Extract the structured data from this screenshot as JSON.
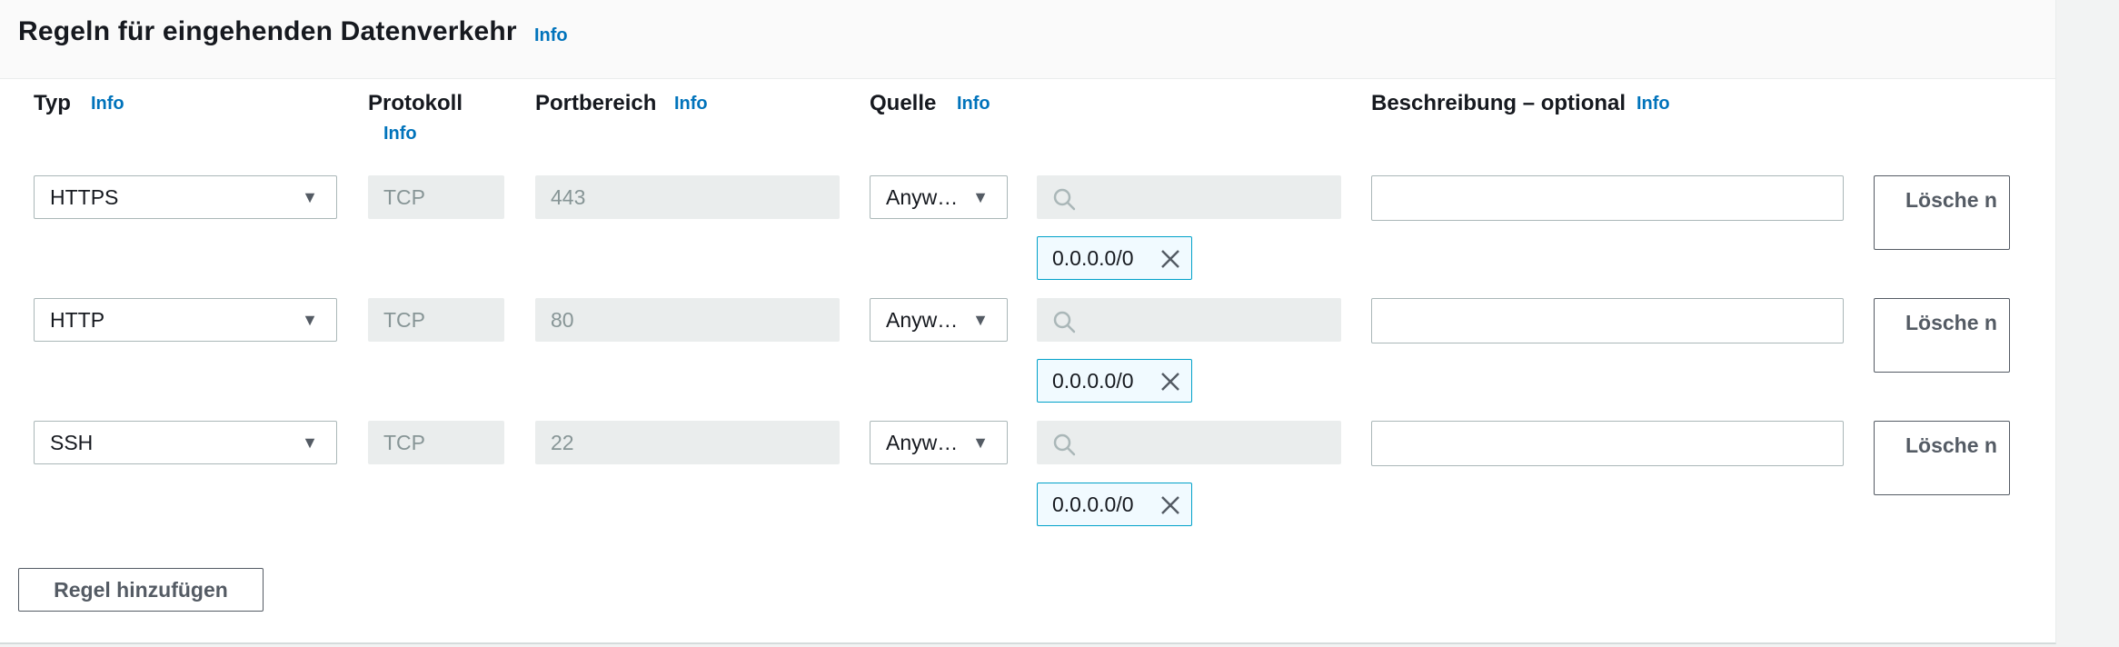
{
  "section": {
    "title": "Regeln für eingehenden Datenverkehr",
    "info": "Info"
  },
  "columns": {
    "type": {
      "label": "Typ",
      "info": "Info"
    },
    "protocol": {
      "label": "Protokoll",
      "info": "Info"
    },
    "port_range": {
      "label": "Portbereich",
      "info": "Info"
    },
    "source": {
      "label": "Quelle",
      "info": "Info"
    },
    "description": {
      "label": "Beschreibung – optional",
      "info": "Info"
    }
  },
  "rules": [
    {
      "type": "HTTPS",
      "protocol": "TCP",
      "port_range": "443",
      "source_type": "Anyw…",
      "search_value": "",
      "cidr": "0.0.0.0/0",
      "description": "",
      "delete_label": "Lösche n"
    },
    {
      "type": "HTTP",
      "protocol": "TCP",
      "port_range": "80",
      "source_type": "Anyw…",
      "search_value": "",
      "cidr": "0.0.0.0/0",
      "description": "",
      "delete_label": "Lösche n"
    },
    {
      "type": "SSH",
      "protocol": "TCP",
      "port_range": "22",
      "source_type": "Anyw…",
      "search_value": "",
      "cidr": "0.0.0.0/0",
      "description": "",
      "delete_label": "Lösche n"
    }
  ],
  "add_rule_label": "Regel hinzufügen",
  "icons": {
    "caret": "caret-down-icon",
    "search": "search-icon",
    "remove": "close-icon"
  },
  "colors": {
    "link": "#0073bb",
    "token_border": "#00a1c9",
    "token_bg": "#f1faff",
    "disabled_bg": "#eaeded"
  }
}
